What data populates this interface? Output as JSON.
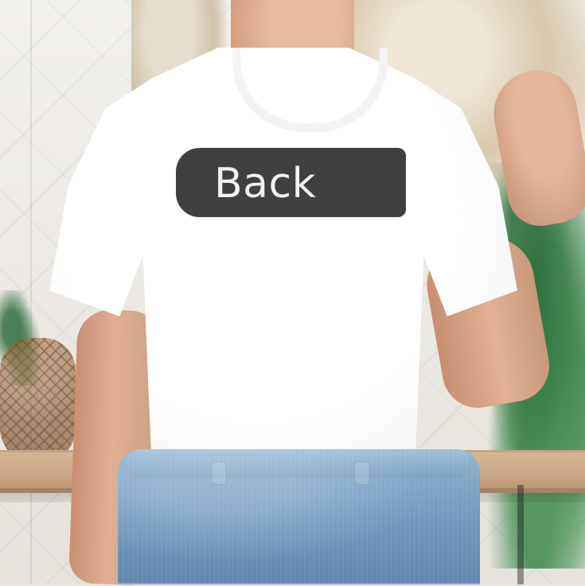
{
  "shirt_graphic": {
    "text": "Back",
    "label_bg": "#3e4041",
    "text_color": "#f2f2f2"
  },
  "scene": {
    "shirt_color": "#ffffff",
    "jeans_color": "#6f97bb"
  }
}
